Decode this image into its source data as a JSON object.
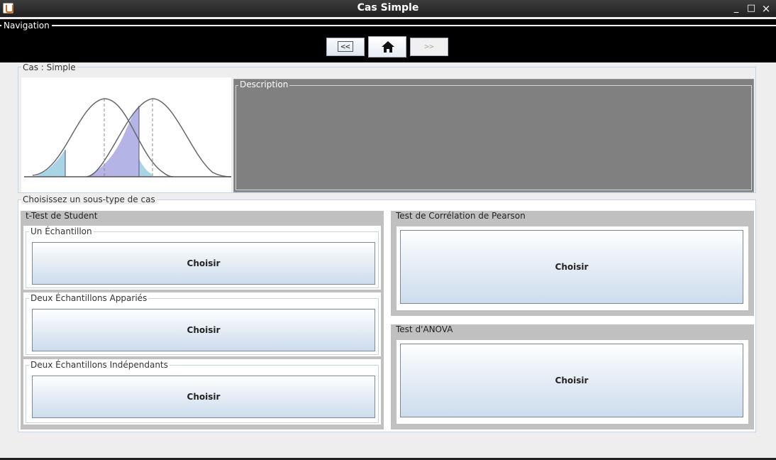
{
  "window": {
    "title": "Cas Simple",
    "controls": [
      "_",
      "□",
      "×"
    ]
  },
  "navigation": {
    "legend": "Navigation",
    "prev_label": "<<",
    "next_label": ">>"
  },
  "cas_panel": {
    "legend": "Cas : Simple",
    "description_legend": "Description"
  },
  "choose": {
    "legend": "Choisissez un sous-type de cas",
    "student": {
      "title": "t-Test de Student",
      "items": [
        {
          "title": "Un Échantillon",
          "button": "Choisir"
        },
        {
          "title": "Deux Échantillons Appariés",
          "button": "Choisir"
        },
        {
          "title": "Deux Échantillons Indépendants",
          "button": "Choisir"
        }
      ]
    },
    "pearson": {
      "title": "Test de Corrélation de Pearson",
      "button": "Choisir"
    },
    "anova": {
      "title": "Test d'ANOVA",
      "button": "Choisir"
    }
  },
  "colors": {
    "nav_bg": "#000000",
    "desc_bg": "#808080",
    "group_bg": "#c0c0c0",
    "shade_blue": "#a8d4e6",
    "shade_purple": "#b4b4e6"
  }
}
